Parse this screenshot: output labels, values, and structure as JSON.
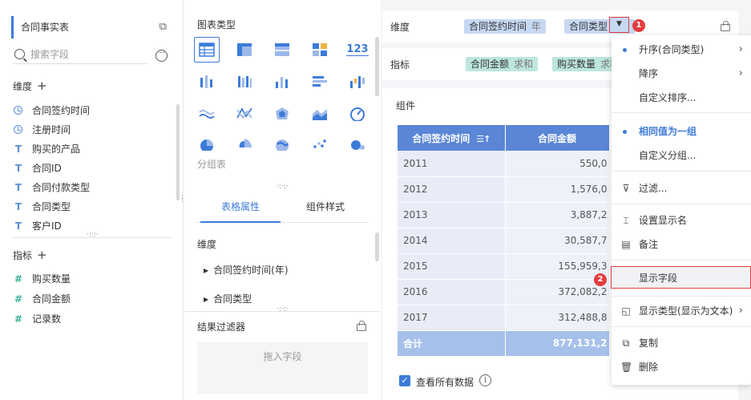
{
  "left": {
    "dataset": "合同事实表",
    "search_placeholder": "搜索字段",
    "dimension_title": "维度",
    "dimensions": [
      {
        "label": "合同签约时间",
        "type": "date"
      },
      {
        "label": "注册时间",
        "type": "date"
      },
      {
        "label": "购买的产品",
        "type": "text"
      },
      {
        "label": "合同ID",
        "type": "text"
      },
      {
        "label": "合同付款类型",
        "type": "text"
      },
      {
        "label": "合同类型",
        "type": "text"
      },
      {
        "label": "客户ID",
        "type": "text"
      }
    ],
    "measure_title": "指标",
    "measures": [
      {
        "label": "购买数量",
        "type": "number"
      },
      {
        "label": "合同金额",
        "type": "number"
      },
      {
        "label": "记录数",
        "type": "number"
      }
    ]
  },
  "middle": {
    "chart_type_title": "图表类型",
    "group_label": "分组表",
    "tabs": [
      "表格属性",
      "组件样式"
    ],
    "dimension_title": "维度",
    "dimension_items": [
      "合同签约时间(年)",
      "合同类型"
    ],
    "result_filter_title": "结果过滤器",
    "drop_hint": "拖入字段"
  },
  "right": {
    "dimension_label": "维度",
    "dim_pills": [
      {
        "label": "合同签约时间",
        "agg": "年"
      },
      {
        "label": "合同类型",
        "agg": ""
      }
    ],
    "measure_label": "指标",
    "measure_pills": [
      {
        "label": "合同金额",
        "agg": "求和"
      },
      {
        "label": "购买数量",
        "agg": "求和"
      }
    ],
    "arrow": "▼",
    "badge1": "1",
    "badge2": "2",
    "component_title": "组件",
    "table": {
      "headers": [
        "合同签约时间",
        "合同金额"
      ],
      "rows": [
        [
          "2011",
          "550,0"
        ],
        [
          "2012",
          "1,576,0"
        ],
        [
          "2013",
          "3,887,2"
        ],
        [
          "2014",
          "30,587,7"
        ],
        [
          "2015",
          "155,959,3"
        ],
        [
          "2016",
          "372,082,2"
        ],
        [
          "2017",
          "312,488,8"
        ]
      ],
      "total": [
        "合计",
        "877,131,2"
      ]
    },
    "show_all_label": "查看所有数据"
  },
  "menu": {
    "items": [
      {
        "label": "升序(合同类型)",
        "selected": false,
        "dot": true,
        "sub": true
      },
      {
        "label": "降序",
        "sub": true
      },
      {
        "label": "自定义排序..."
      },
      {
        "label": "相同值为一组",
        "selected": true,
        "dot": true
      },
      {
        "label": "自定义分组..."
      },
      {
        "label": "过滤...",
        "icon": "filter-icon"
      },
      {
        "label": "设置显示名",
        "icon": "rename-icon"
      },
      {
        "label": "备注",
        "icon": "note-icon"
      },
      {
        "label": "显示字段",
        "highlight": true
      },
      {
        "label": "显示类型(显示为文本)",
        "icon": "display-type-icon",
        "sub": true
      },
      {
        "label": "复制",
        "icon": "copy-icon"
      },
      {
        "label": "删除",
        "icon": "delete-icon"
      }
    ]
  },
  "colors": {
    "accent": "#3d7bd9",
    "dimension_pill": "#c7d8f3",
    "measure_pill": "#bde6dc",
    "table_header": "#5a86d5",
    "highlight_border": "#e43d3d"
  }
}
